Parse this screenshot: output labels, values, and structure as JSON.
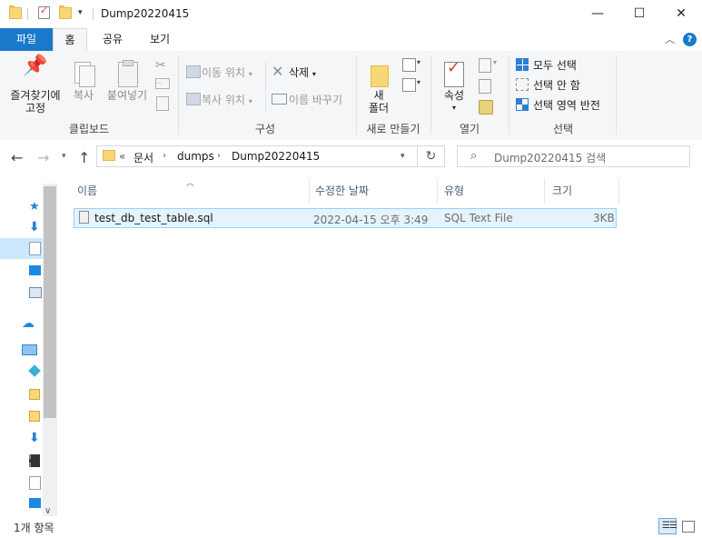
{
  "window": {
    "title": "Dump20220415",
    "minimize_glyph": "—",
    "maximize_glyph": "☐",
    "close_glyph": "✕"
  },
  "ribbon_tabs": {
    "file": "파일",
    "home": "홈",
    "share": "공유",
    "view": "보기"
  },
  "ribbon": {
    "clipboard": {
      "pin_label_1": "즐겨찾기에",
      "pin_label_2": "고정",
      "copy": "복사",
      "paste": "붙여넣기",
      "group": "클립보드"
    },
    "organize": {
      "move_to": "이동 위치",
      "copy_to": "복사 위치",
      "delete": "삭제",
      "rename": "이름 바꾸기",
      "group": "구성"
    },
    "new": {
      "new_folder_1": "새",
      "new_folder_2": "폴더",
      "group": "새로 만들기"
    },
    "open": {
      "properties": "속성",
      "group": "열기"
    },
    "select": {
      "select_all": "모두 선택",
      "select_none": "선택 안 함",
      "invert": "선택 영역 반전",
      "group": "선택"
    }
  },
  "address": {
    "overflow": "«",
    "crumbs": [
      "문서",
      "dumps",
      "Dump20220415"
    ],
    "search_placeholder": "Dump20220415 검색"
  },
  "columns": {
    "name": "이름",
    "modified": "수정한 날짜",
    "type": "유형",
    "size": "크기"
  },
  "files": [
    {
      "name": "test_db_test_table.sql",
      "modified": "2022-04-15 오후 3:49",
      "type": "SQL Text File",
      "size": "3KB"
    }
  ],
  "status": {
    "item_count": "1개 항목"
  },
  "colors": {
    "accent": "#1979ca",
    "selection": "#cce8ff",
    "folder": "#f8d775"
  }
}
